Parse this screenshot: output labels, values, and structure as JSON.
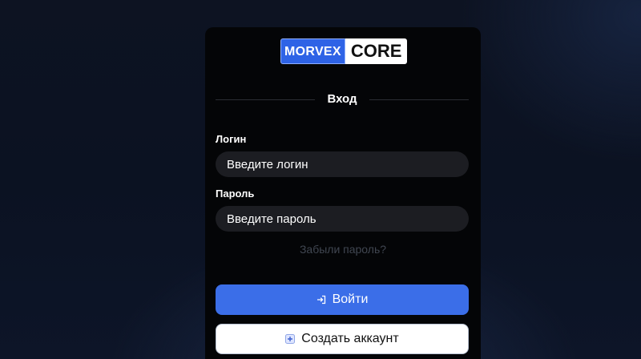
{
  "logo": {
    "left": "MORVEX",
    "right": "CORE"
  },
  "heading": "Вход",
  "login": {
    "label": "Логин",
    "placeholder": "Введите логин"
  },
  "password": {
    "label": "Пароль",
    "placeholder": "Введите пароль"
  },
  "forgot_link": "Забыли пароль?",
  "buttons": {
    "login_label": "Войти",
    "login_icon": "login-arrow-icon",
    "create_label": "Создать аккаунт",
    "create_icon": "plus-square-icon"
  },
  "colors": {
    "accent": "#3b6ee8",
    "logo_blue": "#2e63e6",
    "card_bg": "#040507",
    "input_bg": "#1c1d22",
    "muted_link": "#404651"
  }
}
